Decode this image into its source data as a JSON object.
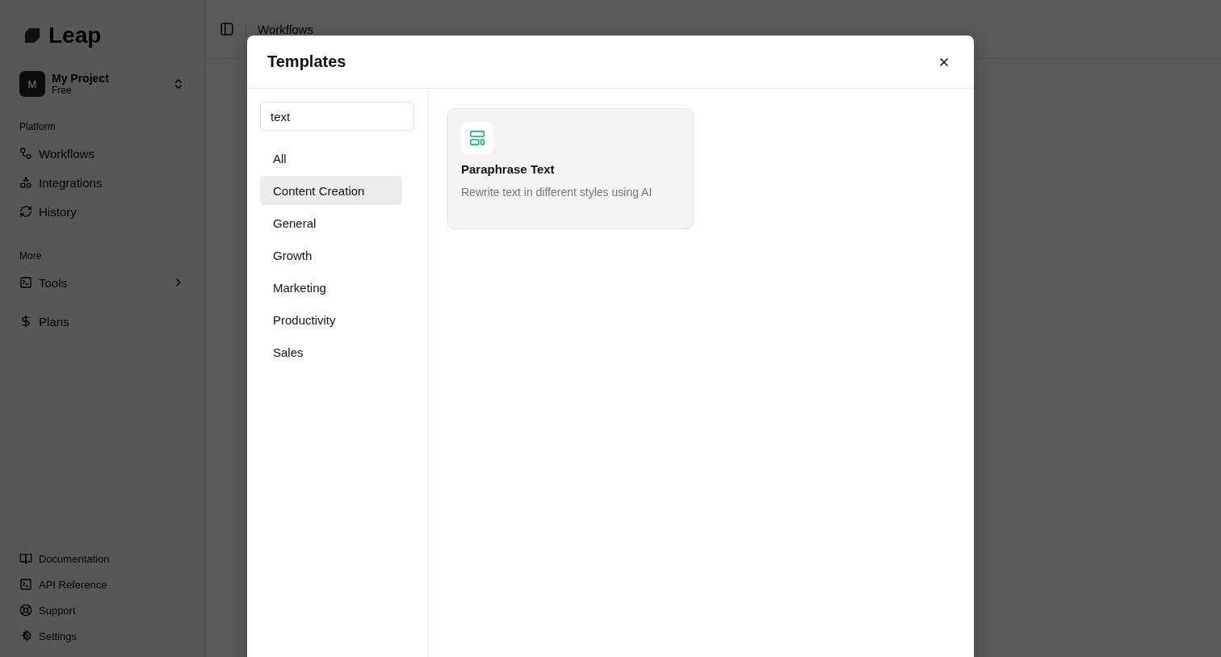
{
  "sidebar": {
    "logo": "Leap",
    "project": {
      "avatar": "M",
      "name": "My Project",
      "plan": "Free"
    },
    "sections": [
      {
        "title": "Platform",
        "items": [
          {
            "label": "Workflows"
          },
          {
            "label": "Integrations"
          },
          {
            "label": "History"
          }
        ]
      },
      {
        "title": "More",
        "items": [
          {
            "label": "Tools",
            "expandable": true
          }
        ]
      },
      {
        "items": [
          {
            "label": "Plans"
          }
        ]
      }
    ],
    "footer": [
      {
        "label": "Documentation"
      },
      {
        "label": "API Reference"
      },
      {
        "label": "Support"
      },
      {
        "label": "Settings"
      }
    ]
  },
  "topbar": {
    "breadcrumb": "Workflows"
  },
  "modal": {
    "title": "Templates",
    "search": {
      "value": "text"
    },
    "categories": [
      {
        "label": "All",
        "selected": false
      },
      {
        "label": "Content Creation",
        "selected": true
      },
      {
        "label": "General",
        "selected": false
      },
      {
        "label": "Growth",
        "selected": false
      },
      {
        "label": "Marketing",
        "selected": false
      },
      {
        "label": "Productivity",
        "selected": false
      },
      {
        "label": "Sales",
        "selected": false
      }
    ],
    "templates": [
      {
        "title": "Paraphrase Text",
        "description": "Rewrite text in different styles using AI"
      }
    ]
  }
}
